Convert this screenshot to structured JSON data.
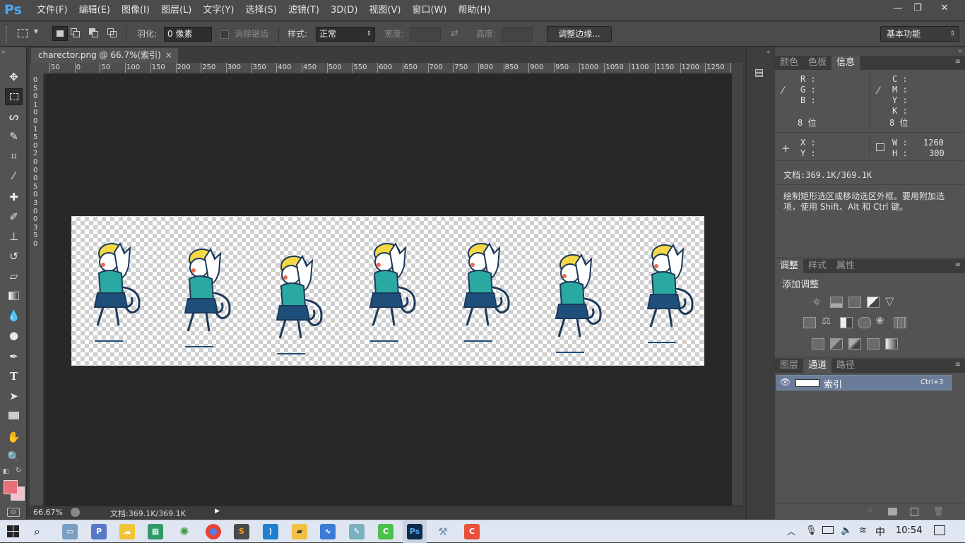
{
  "app": {
    "logo": "Ps"
  },
  "menu": [
    "文件(F)",
    "编辑(E)",
    "图像(I)",
    "图层(L)",
    "文字(Y)",
    "选择(S)",
    "滤镜(T)",
    "3D(D)",
    "视图(V)",
    "窗口(W)",
    "帮助(H)"
  ],
  "window_controls": {
    "minimize": "—",
    "restore": "❐",
    "close": "✕"
  },
  "options": {
    "feather_label": "羽化:",
    "feather_value": "0 像素",
    "antialias_label": "消除锯齿",
    "style_label": "样式:",
    "style_value": "正常",
    "width_label": "宽度:",
    "height_label": "高度:",
    "refine_edge": "调整边缘...",
    "workspace": "基本功能"
  },
  "document": {
    "tab_title": "charector.png @ 66.7%(索引)",
    "close": "×",
    "zoom": "66.67%",
    "doc_size": "文档:369.1K/369.1K"
  },
  "ruler_top_labels": [
    "50",
    "0",
    "50",
    "100",
    "150",
    "200",
    "250",
    "300",
    "350",
    "400",
    "450",
    "500",
    "550",
    "600",
    "650",
    "700",
    "750",
    "800",
    "850",
    "900",
    "950",
    "1000",
    "1050",
    "1100",
    "1150",
    "1200",
    "1250",
    "1"
  ],
  "ruler_left_labels": [
    "0",
    "5",
    "0",
    "1",
    "0",
    "0",
    "1",
    "5",
    "0",
    "2",
    "0",
    "0",
    "0",
    "5",
    "0",
    "3",
    "0",
    "0",
    "3",
    "5",
    "0"
  ],
  "info_panel": {
    "tabs": [
      "颜色",
      "色板",
      "信息"
    ],
    "active_tab": "信息",
    "rgb_labels": [
      "R :",
      "G :",
      "B :"
    ],
    "cmyk_labels": [
      "C :",
      "M :",
      "Y :",
      "K :"
    ],
    "bit_left": "8 位",
    "bit_right": "8 位",
    "xy_labels": [
      "X :",
      "Y :"
    ],
    "w_label": "W :",
    "h_label": "H :",
    "w_value": "1260",
    "h_value": "300",
    "doc_size": "文档:369.1K/369.1K",
    "hint": "绘制矩形选区或移动选区外框。要用附加选项，使用 Shift、Alt 和 Ctrl 键。"
  },
  "adjust_panel": {
    "tabs": [
      "调整",
      "样式",
      "属性"
    ],
    "active_tab": "调整",
    "title": "添加调整"
  },
  "channels_panel": {
    "tabs": [
      "图层",
      "通道",
      "路径"
    ],
    "active_tab": "通道",
    "channel_name": "索引",
    "shortcut": "Ctrl+3"
  },
  "taskbar": {
    "time": "10:54",
    "ime": "中",
    "apps": [
      "P",
      "S",
      "C",
      "Ps",
      "C"
    ]
  },
  "colors": {
    "fg_swatch": "#e8707a",
    "bg_swatch": "#f2c0cf",
    "ps_blue": "#48a9f8",
    "sprite_teal": "#2aa9a3",
    "sprite_yellow": "#f5d845",
    "sprite_navy": "#1e4f7a"
  }
}
